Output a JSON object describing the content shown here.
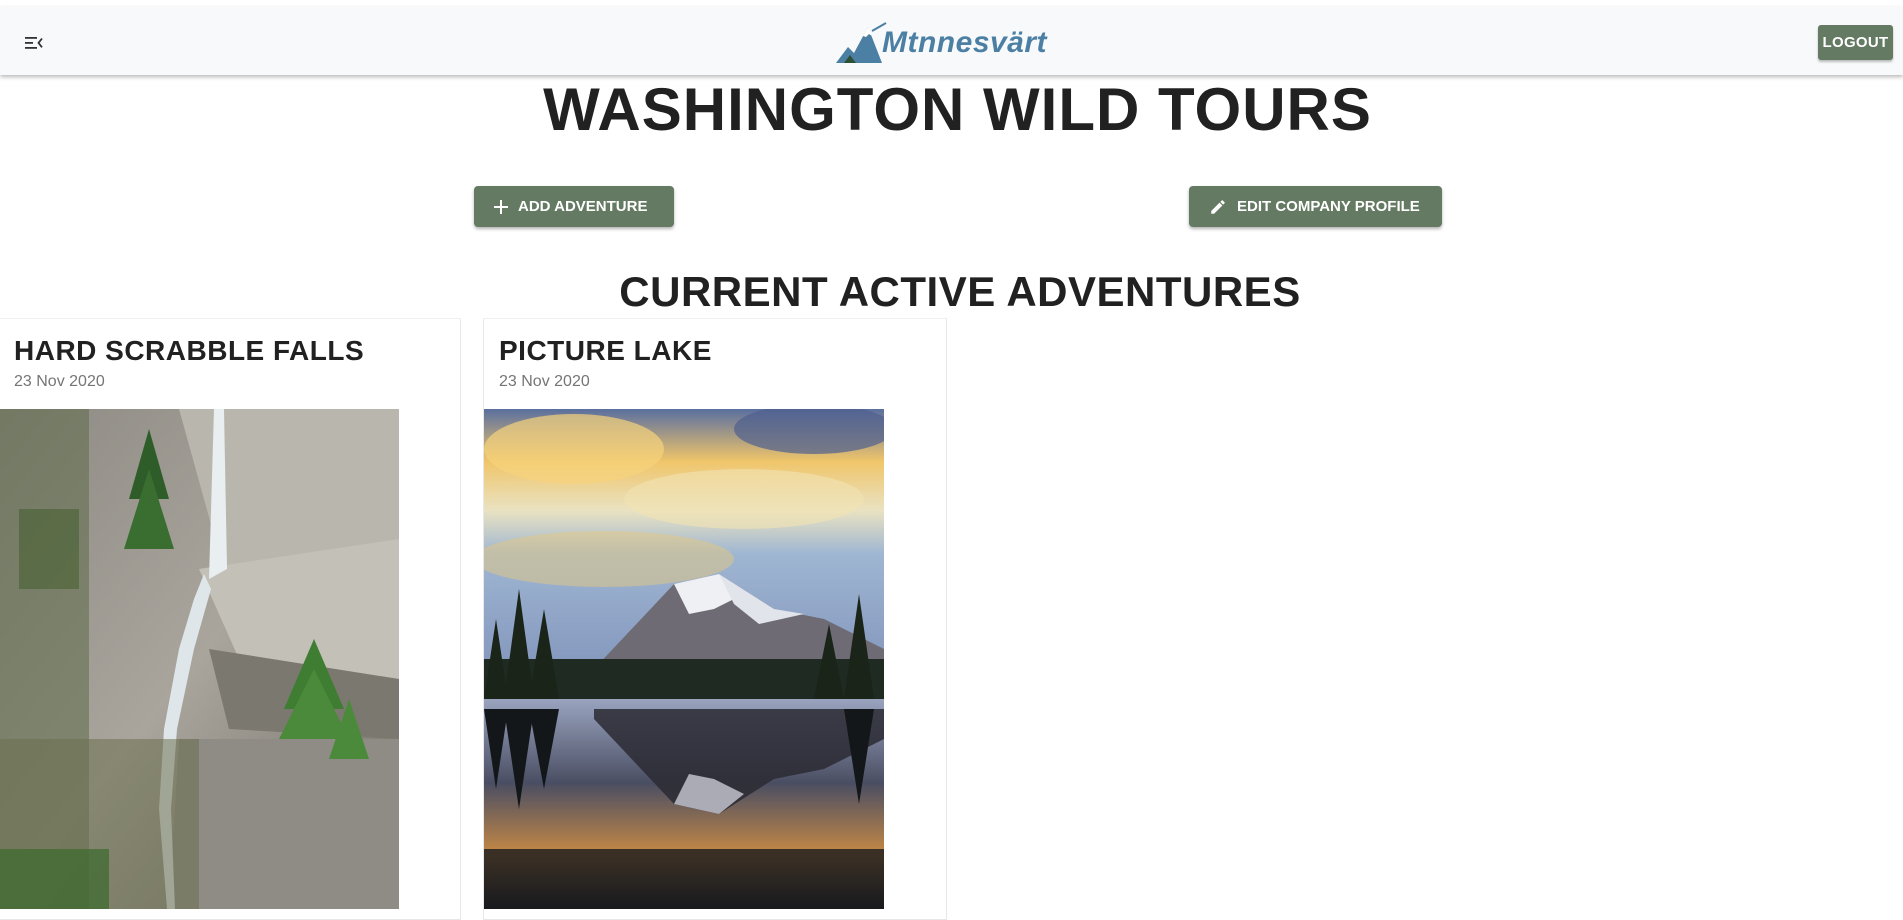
{
  "header": {
    "logo_text": "Mtnnesvärt",
    "menu_icon": "menu-collapse-icon",
    "logout_label": "LOGOUT"
  },
  "page": {
    "title": "WASHINGTON WILD TOURS"
  },
  "actions": {
    "add_label": "ADD ADVENTURE",
    "add_icon": "plus-icon",
    "edit_label": "EDIT COMPANY PROFILE",
    "edit_icon": "pencil-icon"
  },
  "section": {
    "title": "CURRENT ACTIVE ADVENTURES"
  },
  "adventures": [
    {
      "title": "HARD SCRABBLE FALLS",
      "date": "23 Nov 2020",
      "image": "waterfall-photo"
    },
    {
      "title": "PICTURE LAKE",
      "date": "23 Nov 2020",
      "image": "mountain-lake-photo"
    }
  ],
  "colors": {
    "accent": "#657a63",
    "logo_blue": "#4b7fa3",
    "appbar_bg": "#f8f9fb",
    "text": "#212121",
    "muted": "#757575"
  }
}
